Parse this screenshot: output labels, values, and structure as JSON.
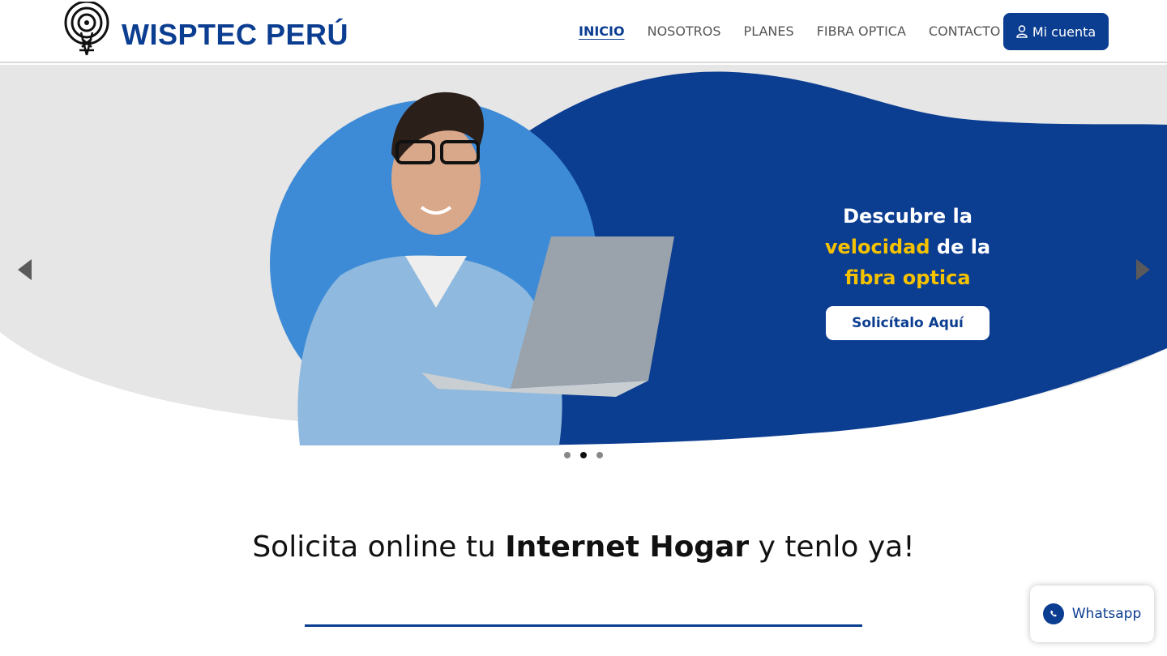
{
  "header": {
    "logo_text": "WISPTEC PERÚ",
    "nav": [
      {
        "label": "INICIO",
        "active": true
      },
      {
        "label": "NOSOTROS",
        "active": false
      },
      {
        "label": "PLANES",
        "active": false
      },
      {
        "label": "FIBRA OPTICA",
        "active": false
      },
      {
        "label": "CONTACTO",
        "active": false
      }
    ],
    "account_label": "Mi cuenta"
  },
  "hero": {
    "line1": "Descubre la",
    "line2_highlight": "velocidad",
    "line2_rest": " de la",
    "line3_highlight": "fibra optica",
    "cta_label": "Solicítalo Aquí",
    "slides_total": 3,
    "active_slide": 2
  },
  "section": {
    "title_start": "Solicita online tu ",
    "title_bold": "Internet Hogar",
    "title_end": " y tenlo ya!"
  },
  "whatsapp": {
    "label": "Whatsapp"
  },
  "colors": {
    "brand_blue": "#0b3d91",
    "highlight_yellow": "#f5c200",
    "hero_circle": "#3d8bd6"
  }
}
